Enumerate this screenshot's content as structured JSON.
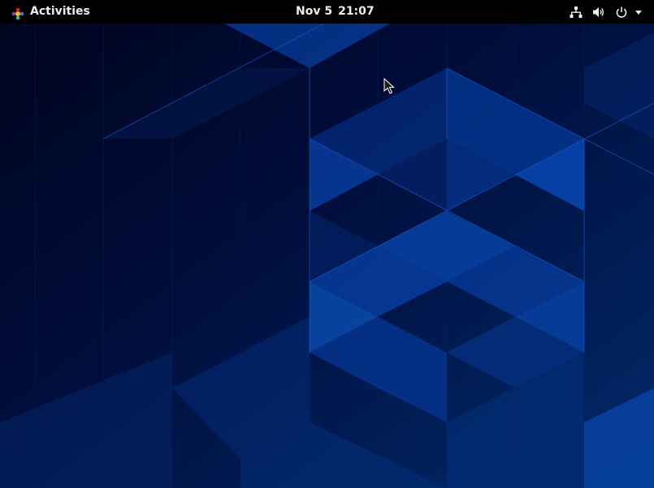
{
  "top_bar": {
    "activities_label": "Activities",
    "clock": {
      "date": "Nov 5",
      "time": "21:07"
    },
    "tray_icons": [
      "network-wired-icon",
      "volume-icon",
      "power-icon",
      "chevron-down-icon"
    ]
  },
  "colors": {
    "top_bar_bg": "#000000",
    "top_bar_text": "#eeeeec",
    "wallpaper_dark": "#00092b",
    "wallpaper_mid": "#002a6e",
    "wallpaper_light": "#0a4aa8"
  }
}
